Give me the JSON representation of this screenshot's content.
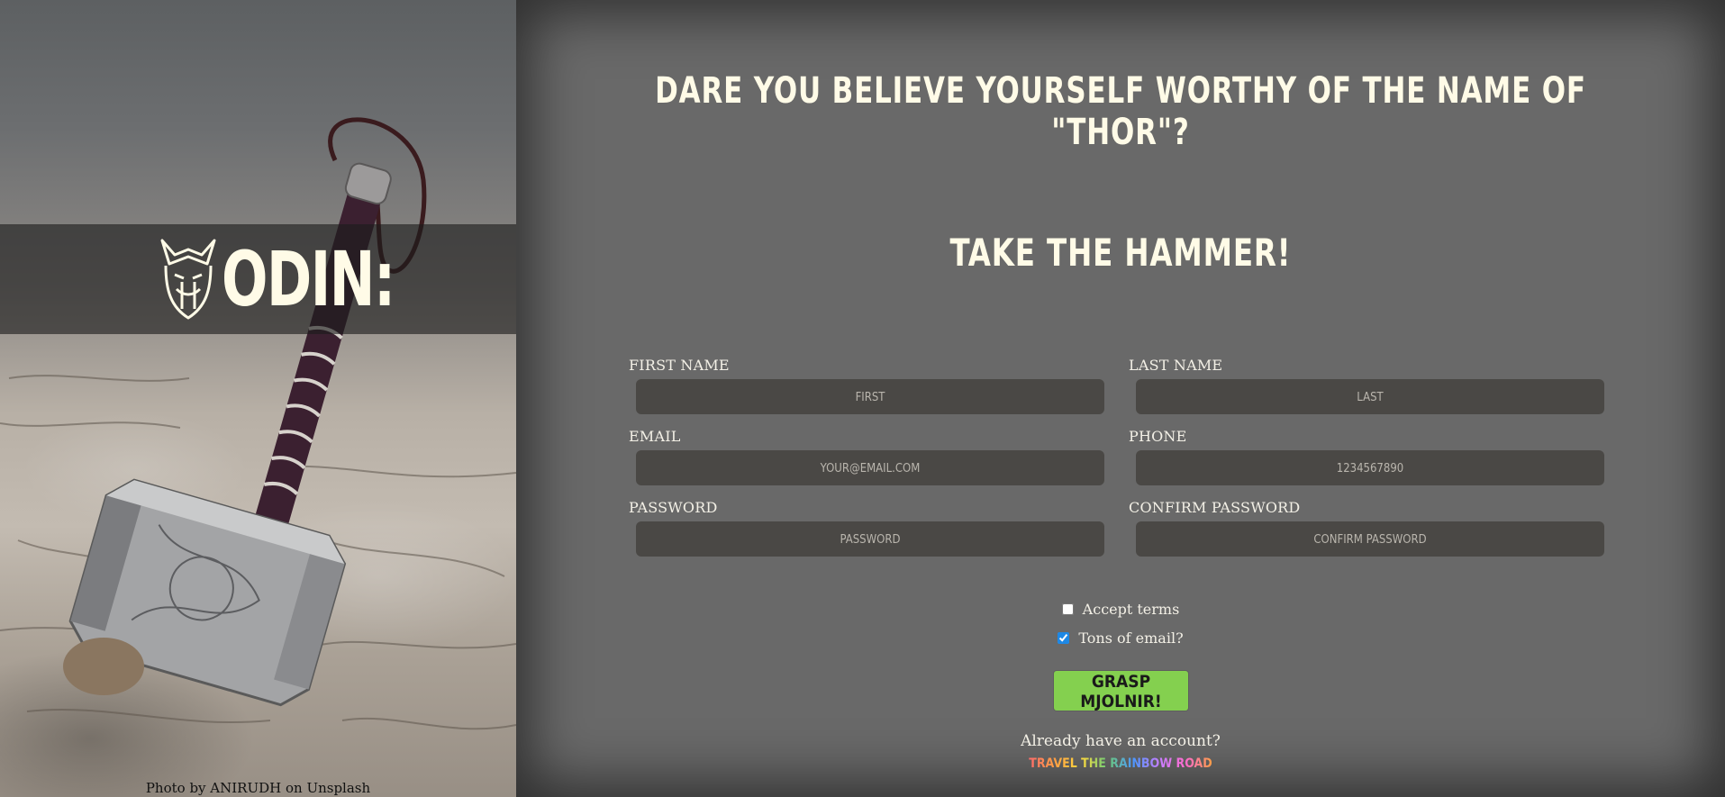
{
  "left_panel": {
    "brand": "ODIN:",
    "logo_icon": "viking-helmet-icon",
    "credit": "Photo by ANIRUDH on Unsplash"
  },
  "main": {
    "headline": "Dare you believe yourself worthy of the name of \"Thor\"?",
    "subhead": "Take the hammer!"
  },
  "form": {
    "fields": [
      {
        "label": "FIRST NAME",
        "placeholder": "First"
      },
      {
        "label": "LAST NAME",
        "placeholder": "Last"
      },
      {
        "label": "EMAIL",
        "placeholder": "your@email.com"
      },
      {
        "label": "PHONE",
        "placeholder": "1234567890"
      },
      {
        "label": "PASSWORD",
        "placeholder": "Password"
      },
      {
        "label": "CONFIRM PASSWORD",
        "placeholder": "Confirm Password"
      }
    ],
    "checkboxes": [
      {
        "label": "Accept terms",
        "checked": false
      },
      {
        "label": "Tons of email?",
        "checked": true
      }
    ],
    "submit_label": "Grasp Mjolnir!",
    "already_text": "Already have an account?",
    "login_link": "Travel the rainbow road"
  },
  "colors": {
    "background": "#696969",
    "accent_button": "#84d04f",
    "input_bg": "#4a4845",
    "display_text": "#fffbe7"
  }
}
